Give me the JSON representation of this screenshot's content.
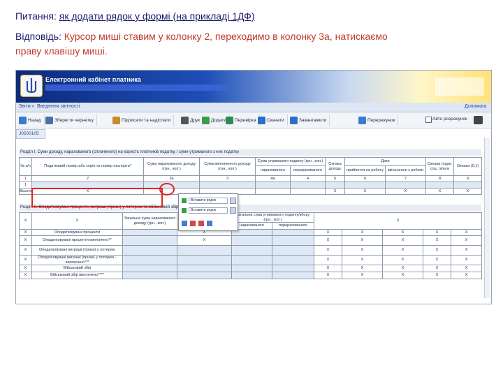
{
  "question": {
    "label": "Питання",
    "colon": ": ",
    "text": "як додати рядок у формі (на прикладі 1ДФ)"
  },
  "answer": {
    "label": "Відповідь",
    "colon": ": ",
    "line1": "Курсор миші ставим у колонку 2, переходимо в колонку 3а, натискаємо",
    "line2": "праву клавішу миші."
  },
  "app": {
    "title": "Електронний кабінет платника",
    "breadcrumb_home": "Звіти",
    "breadcrumb_page": "Введення звітності",
    "breadcrumb_right": "Допомога",
    "tab": "J0500105"
  },
  "toolbar": {
    "back": "Назад",
    "save_draft": "Зберегти чернетку",
    "sign_send": "Підписати та надіслати",
    "print": "Друк",
    "add": "Додати",
    "check": "Перевірка",
    "download": "Скачати",
    "load": "Завантажити",
    "recalc": "Перерахунок",
    "autocalc": "Авто розрахунок"
  },
  "colors": {
    "accent_red": "#e0261f",
    "header_blue": "#1d4fb8",
    "header_gold": "#ffe27a"
  },
  "section1": {
    "title": "Розділ І. Суми доходу, нарахованого (сплаченого) на користь платників податку, і суми утриманого з них податку",
    "headers": {
      "num": "№ з/п",
      "taxid": "Податковий номер або серія та номер паспорта*",
      "accrued": "Сума нарахованого доходу (грн., коп.)",
      "paid": "Сума виплаченого доходу (грн., коп.)",
      "withheld": "Сума утриманого податку (грн., коп.)",
      "withheld_acc": "нарахованого",
      "withheld_trans": "перерахованого",
      "sign_income": "Ознака доходу",
      "date": "Дата",
      "date_hire": "прийняття на роботу",
      "date_fire": "звільнення з роботи",
      "priv": "Ознака подат. соц. пільги",
      "mark": "Ознака (0,1)"
    },
    "colnums": [
      "1",
      "2",
      "3а",
      "3",
      "4а",
      "4",
      "5",
      "6",
      "7",
      "8",
      "9"
    ],
    "row_num": "1",
    "row_num2": "1",
    "total_label": "Всього",
    "x": "X"
  },
  "context_menu": {
    "item1": "Вставити рядок",
    "item2": "Вставити рядок"
  },
  "section2": {
    "title": "Розділ ІІ. Оподатковувані проценти, виграші (призи) у лотерею та військовий збір",
    "headers": {
      "total_accrued": "Загальна сума нарахованого доходу (грн., коп.)",
      "total_withheld": "Загальна сума утриманого податку/збору (грн., коп.)",
      "acc": "нарахованого",
      "trans": "перерахованого"
    },
    "x": "X",
    "rows": [
      "Оподатковувані проценти",
      "Оподатковувані проценти виплачено**",
      "Оподатковувані виграші (призи) у лотерею",
      "Оподатковувані виграші (призи) у лотерею - виплачено***",
      "Військовий збір",
      "Військовий збір виплачено****"
    ]
  }
}
